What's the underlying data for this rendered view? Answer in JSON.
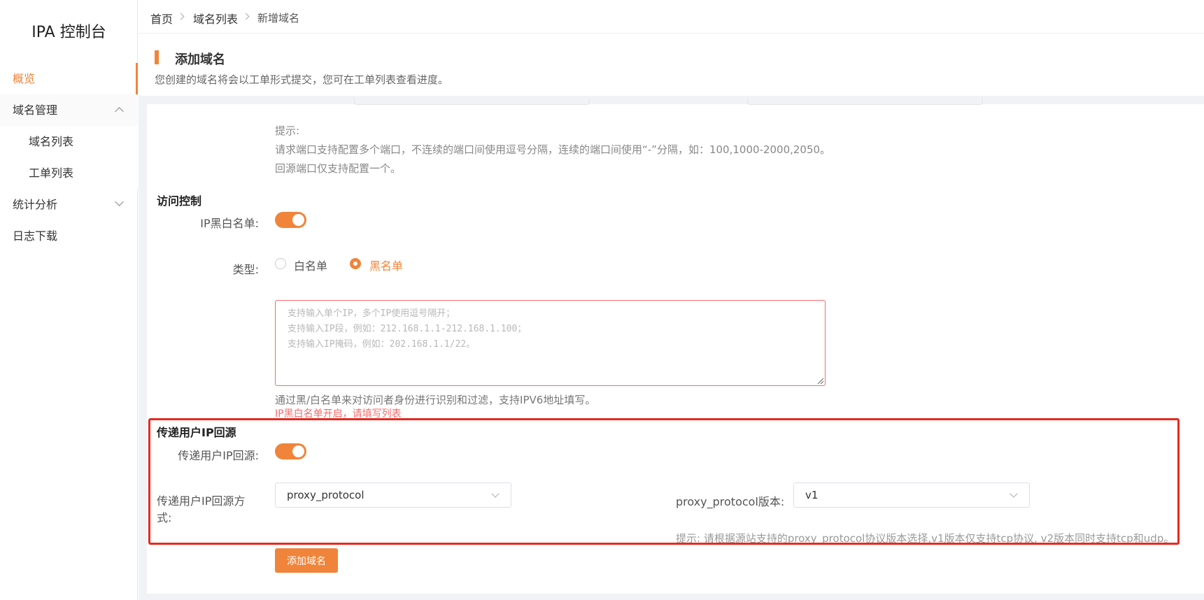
{
  "app": {
    "title": "IPA 控制台"
  },
  "sidebar": {
    "items": [
      {
        "label": "概览"
      },
      {
        "label": "域名管理"
      },
      {
        "label": "域名列表"
      },
      {
        "label": "工单列表"
      },
      {
        "label": "统计分析"
      },
      {
        "label": "日志下载"
      }
    ]
  },
  "breadcrumb": {
    "home": "首页",
    "list": "域名列表",
    "current": "新增域名"
  },
  "page": {
    "title": "添加域名",
    "subtitle": "您创建的域名将会以工单形式提交，您可在工单列表查看进度。"
  },
  "port_tip": {
    "title": "提示:",
    "line1": "请求端口支持配置多个端口，不连续的端口间使用逗号分隔，连续的端口间使用“-”分隔，如：100,1000-2000,2050。",
    "line2": "回源端口仅支持配置一个。"
  },
  "access_control": {
    "section_title": "访问控制",
    "ip_list_label": "IP黑白名单:",
    "ip_list_enabled": true,
    "type_label": "类型:",
    "options": [
      {
        "label": "白名单",
        "checked": false
      },
      {
        "label": "黑名单",
        "checked": true
      }
    ],
    "textarea_placeholder": "支持输入单个IP，多个IP使用逗号隔开；\n支持输入IP段，例如：212.168.1.1-212.168.1.100；\n支持输入IP掩码，例如：202.168.1.1/22。",
    "help": "通过黑/白名单来对访问者身份进行识别和过滤，支持IPV6地址填写。",
    "error": "IP黑白名单开启，请填写列表"
  },
  "pass_ip": {
    "section_title": "传递用户IP回源",
    "switch_label": "传递用户IP回源:",
    "enabled": true,
    "method_label": "传递用户IP回源方式:",
    "method_value": "proxy_protocol",
    "version_label": "proxy_protocol版本:",
    "version_value": "v1",
    "tip": "提示: 请根据源站支持的proxy_protocol协议版本选择,v1版本仅支持tcp协议, v2版本同时支持tcp和udp。"
  },
  "submit": {
    "label": "添加域名"
  },
  "colors": {
    "accent": "#f0843a",
    "error": "#f56c6c",
    "highlight": "#e8281f"
  }
}
